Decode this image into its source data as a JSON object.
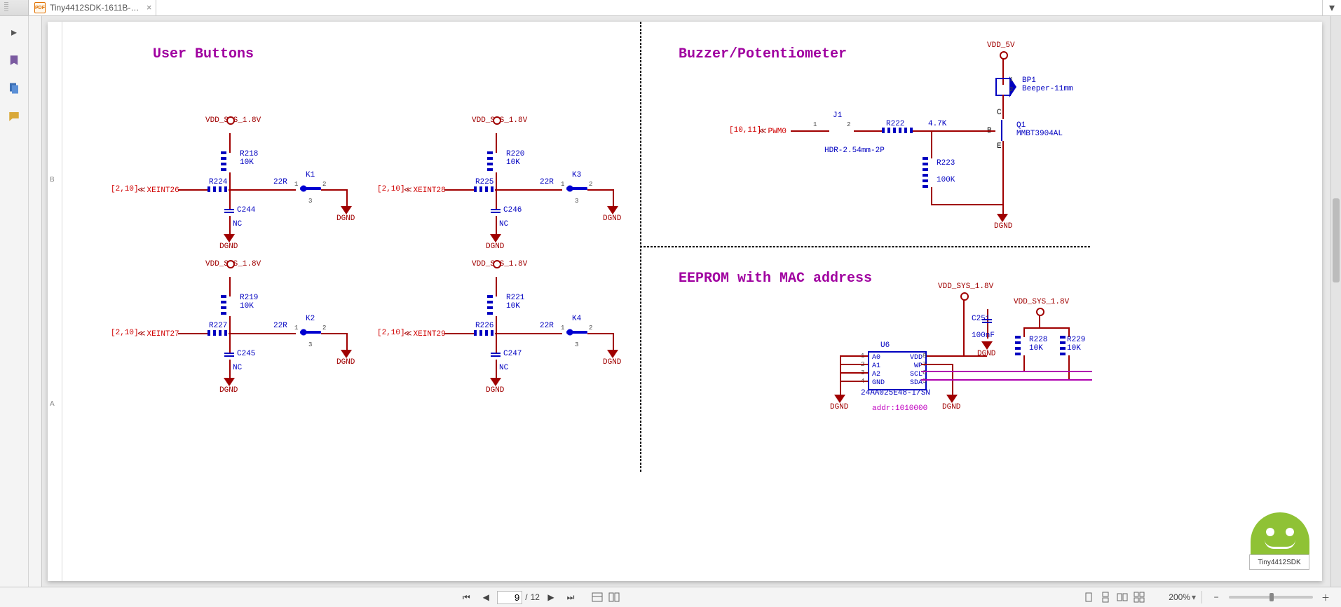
{
  "tab": {
    "title": "Tiny4412SDK-1611B-…",
    "icon": "PDF"
  },
  "sections": {
    "user_buttons": {
      "title": "User Buttons"
    },
    "buzzer": {
      "title": "Buzzer/Potentiometer"
    },
    "eeprom": {
      "title": "EEPROM with MAC address"
    }
  },
  "button_blocks": [
    {
      "id": "K1",
      "vdd": "VDD_SYS_1.8V",
      "r_pull": {
        "ref": "R218",
        "val": "10K"
      },
      "r_ser": {
        "ref": "R224",
        "val": "22R"
      },
      "cap": {
        "ref": "C244",
        "val": "NC"
      },
      "port": {
        "bus": "[2,10]",
        "name": "XEINT26"
      },
      "gnd": "DGND"
    },
    {
      "id": "K3",
      "vdd": "VDD_SYS_1.8V",
      "r_pull": {
        "ref": "R220",
        "val": "10K"
      },
      "r_ser": {
        "ref": "R225",
        "val": "22R"
      },
      "cap": {
        "ref": "C246",
        "val": "NC"
      },
      "port": {
        "bus": "[2,10]",
        "name": "XEINT28"
      },
      "gnd": "DGND"
    },
    {
      "id": "K2",
      "vdd": "VDD_SYS_1.8V",
      "r_pull": {
        "ref": "R219",
        "val": "10K"
      },
      "r_ser": {
        "ref": "R227",
        "val": "22R"
      },
      "cap": {
        "ref": "C245",
        "val": "NC"
      },
      "port": {
        "bus": "[2,10]",
        "name": "XEINT27"
      },
      "gnd": "DGND"
    },
    {
      "id": "K4",
      "vdd": "VDD_SYS_1.8V",
      "r_pull": {
        "ref": "R221",
        "val": "10K"
      },
      "r_ser": {
        "ref": "R226",
        "val": "22R"
      },
      "cap": {
        "ref": "C247",
        "val": "NC"
      },
      "port": {
        "bus": "[2,10]",
        "name": "XEINT29"
      },
      "gnd": "DGND"
    }
  ],
  "buzzer_block": {
    "vdd": "VDD_5V",
    "beeper": {
      "ref": "BP1",
      "val": "Beeper-11mm"
    },
    "transistor": {
      "ref": "Q1",
      "val": "MMBT3904AL",
      "pins": {
        "b": "B",
        "c": "C",
        "e": "E"
      }
    },
    "r_base": {
      "ref": "R222",
      "val": "4.7K"
    },
    "r_pull": {
      "ref": "R223",
      "val": "100K"
    },
    "jumper": {
      "ref": "J1",
      "val": "HDR-2.54mm-2P",
      "pins": [
        "1",
        "2"
      ]
    },
    "port": {
      "bus": "[10,11]",
      "name": "PWM0"
    },
    "gnd": "DGND"
  },
  "eeprom_block": {
    "vdd": "VDD_SYS_1.8V",
    "vdd_pull": "VDD_SYS_1.8V",
    "ic": {
      "ref": "U6",
      "part": "24AA025E48-I/SN",
      "addr": "addr:1010000",
      "left_pins": [
        {
          "n": "1",
          "sig": "A0"
        },
        {
          "n": "2",
          "sig": "A1"
        },
        {
          "n": "3",
          "sig": "A2"
        },
        {
          "n": "4",
          "sig": "GND"
        }
      ],
      "right_pins": [
        {
          "n": "8",
          "sig": "VDD"
        },
        {
          "n": "7",
          "sig": "WP"
        },
        {
          "n": "6",
          "sig": "SCL"
        },
        {
          "n": "5",
          "sig": "SDA"
        }
      ]
    },
    "cap": {
      "ref": "C251",
      "val": "100nF"
    },
    "r_scl": {
      "ref": "R228",
      "val": "10K"
    },
    "r_sda": {
      "ref": "R229",
      "val": "10K"
    },
    "gnd": "DGND"
  },
  "nav": {
    "current_page": "9",
    "total_pages": "12",
    "sep": "/",
    "zoom": "200%"
  },
  "badge": "Tiny4412SDK",
  "margin_letters": {
    "top": "B",
    "bottom": "A"
  }
}
